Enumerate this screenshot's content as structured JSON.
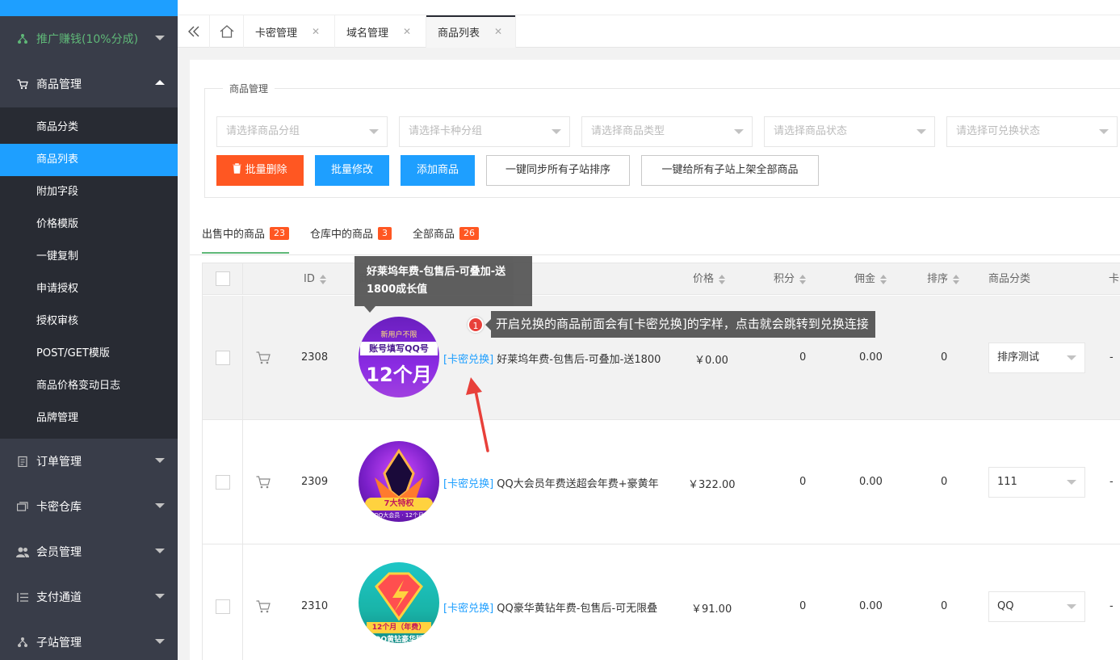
{
  "sidebar": {
    "promo": {
      "label": "推广赚钱(10%分成)"
    },
    "goods": {
      "label": "商品管理"
    },
    "sub_items": [
      {
        "label": "商品分类"
      },
      {
        "label": "商品列表"
      },
      {
        "label": "附加字段"
      },
      {
        "label": "价格模版"
      },
      {
        "label": "一键复制"
      },
      {
        "label": "申请授权"
      },
      {
        "label": "授权审核"
      },
      {
        "label": "POST/GET模版"
      },
      {
        "label": "商品价格变动日志"
      },
      {
        "label": "品牌管理"
      }
    ],
    "orders": {
      "label": "订单管理"
    },
    "cards": {
      "label": "卡密仓库"
    },
    "members": {
      "label": "会员管理"
    },
    "payment": {
      "label": "支付通道"
    },
    "substation": {
      "label": "子站管理"
    }
  },
  "tabs": [
    {
      "label": "卡密管理"
    },
    {
      "label": "域名管理"
    },
    {
      "label": "商品列表"
    }
  ],
  "filters": {
    "legend": "商品管理",
    "selects": [
      {
        "placeholder": "请选择商品分组"
      },
      {
        "placeholder": "请选择卡种分组"
      },
      {
        "placeholder": "请选择商品类型"
      },
      {
        "placeholder": "请选择商品状态"
      },
      {
        "placeholder": "请选择可兑换状态"
      }
    ],
    "buttons": {
      "batch_delete": "批量删除",
      "batch_edit": "批量修改",
      "add": "添加商品",
      "sync_sort": "一键同步所有子站排序",
      "publish_all": "一键给所有子站上架全部商品"
    }
  },
  "status_tabs": [
    {
      "label": "出售中的商品",
      "count": "23"
    },
    {
      "label": "仓库中的商品",
      "count": "3"
    },
    {
      "label": "全部商品",
      "count": "26"
    }
  ],
  "table": {
    "headers": {
      "id": "ID",
      "product": "商品",
      "price": "价格",
      "points": "积分",
      "commission": "佣金",
      "sort": "排序",
      "category": "商品分类",
      "more": "卡"
    },
    "rows": [
      {
        "id": "2308",
        "tag": "[卡密兑换]",
        "name": "好莱坞年费-包售后-可叠加-送1800",
        "price": "￥0.00",
        "points": "0",
        "commission": "0.00",
        "sort": "0",
        "category": "排序测试",
        "extra": "-"
      },
      {
        "id": "2309",
        "tag": "[卡密兑换]",
        "name": "QQ大会员年费送超会年费+豪黄年",
        "price": "￥322.00",
        "points": "0",
        "commission": "0.00",
        "sort": "0",
        "category": "111",
        "extra": "-"
      },
      {
        "id": "2310",
        "tag": "[卡密兑换]",
        "name": "QQ豪华黄钻年费-包售后-可无限叠",
        "price": "￥91.00",
        "points": "0",
        "commission": "0.00",
        "sort": "0",
        "category": "QQ",
        "extra": "-"
      }
    ]
  },
  "tooltip": {
    "line1": "好莱坞年费-包售后-可叠加-送",
    "line2": "1800成长值"
  },
  "annotation": {
    "number": "1",
    "text": "开启兑换的商品前面会有[卡密兑换]的字样，点击就会跳转到兑换连接"
  },
  "thumbs": {
    "t1": {
      "top": "新用户不限",
      "mid": "账号填写QQ号",
      "big": "12个月"
    },
    "t2": {
      "big": "7大特权",
      "small": "QQ大会员 · 12个月"
    },
    "t3": {
      "big": "12个月（年费）",
      "small": "QQ黄钻豪华版"
    }
  },
  "colors": {
    "accent": "#1e9fff",
    "danger": "#ff5722",
    "sidebar": "#393d49",
    "sidebar_sub": "#282b33",
    "success": "#5fb878"
  }
}
